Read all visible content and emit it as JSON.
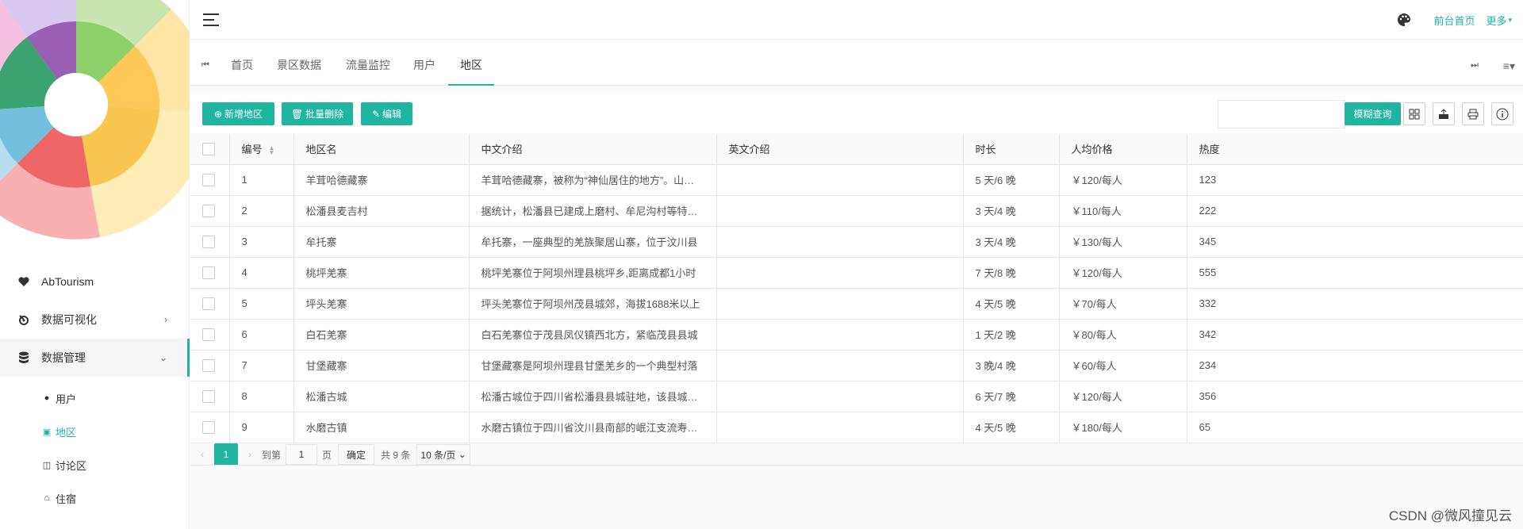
{
  "sidebar": {
    "items": [
      {
        "label": "AbTourism",
        "icon": "heart-icon"
      },
      {
        "label": "数据可视化",
        "icon": "chart-icon",
        "arrow": "›"
      },
      {
        "label": "数据管理",
        "icon": "database-icon",
        "arrow": "⌄"
      }
    ],
    "sub_items": [
      {
        "label": "用户",
        "icon": "user-icon"
      },
      {
        "label": "地区",
        "icon": "region-icon"
      },
      {
        "label": "讨论区",
        "icon": "discussion-icon"
      },
      {
        "label": "住宿",
        "icon": "home-icon"
      }
    ]
  },
  "header": {
    "frontpage_link": "前台首页",
    "more_link": "更多"
  },
  "tabs": [
    "首页",
    "景区数据",
    "流量监控",
    "用户",
    "地区"
  ],
  "toolbar": {
    "add_label": "新增地区",
    "batch_delete_label": "批量删除",
    "edit_label": "编辑",
    "search_button": "模糊查询",
    "search_value": ""
  },
  "table": {
    "columns": [
      "编号",
      "地区名",
      "中文介绍",
      "英文介绍",
      "时长",
      "人均价格",
      "热度"
    ],
    "rows": [
      [
        "1",
        "羊茸哈德藏寨",
        "羊茸哈德藏寨，被称为“神仙居住的地方”。山上森林茂密",
        "",
        "5 天/6 晚",
        "￥120/每人",
        "123"
      ],
      [
        "2",
        "松潘县麦吉村",
        "据统计，松潘县已建成上磨村、牟尼沟村等特色村寨",
        "",
        "3 天/4 晚",
        "￥110/每人",
        "222"
      ],
      [
        "3",
        "牟托寨",
        "牟托寨，一座典型的羌族聚居山寨，位于汶川县",
        "",
        "3 天/4 晚",
        "￥130/每人",
        "345"
      ],
      [
        "4",
        "桃坪羌寨",
        "桃坪羌寨位于阿坝州理县桃坪乡,距离成都1小时",
        "",
        "7 天/8 晚",
        "￥120/每人",
        "555"
      ],
      [
        "5",
        "坪头羌寨",
        "坪头羌寨位于阿坝州茂县城郊，海拔1688米以上",
        "",
        "4 天/5 晚",
        "￥70/每人",
        "332"
      ],
      [
        "6",
        "白石羌寨",
        "白石羌寨位于茂县凤仪镇西北方，紧临茂县县城",
        "",
        "1 天/2 晚",
        "￥80/每人",
        "342"
      ],
      [
        "7",
        "甘堡藏寨",
        "甘堡藏寨是阿坝州理县甘堡羌乡的一个典型村落",
        "",
        "3 晚/4 晚",
        "￥60/每人",
        "234"
      ],
      [
        "8",
        "松潘古城",
        "松潘古城位于四川省松潘县县城驻地，该县城历史悠久",
        "",
        "6 天/7 晚",
        "￥120/每人",
        "356"
      ],
      [
        "9",
        "水磨古镇",
        "水磨古镇位于四川省汶川县南部的岷江支流寿溪河畔",
        "",
        "4 天/5 晚",
        "￥180/每人",
        "65"
      ]
    ]
  },
  "pager": {
    "current": "1",
    "goto_label": "到第",
    "goto_value": "1",
    "page_label": "页",
    "ok_label": "确定",
    "total_label": "共 9 条",
    "size_label": "10 条/页"
  },
  "watermark": "CSDN @微风撞见云",
  "colors": {
    "accent": "#1fb5a1"
  }
}
